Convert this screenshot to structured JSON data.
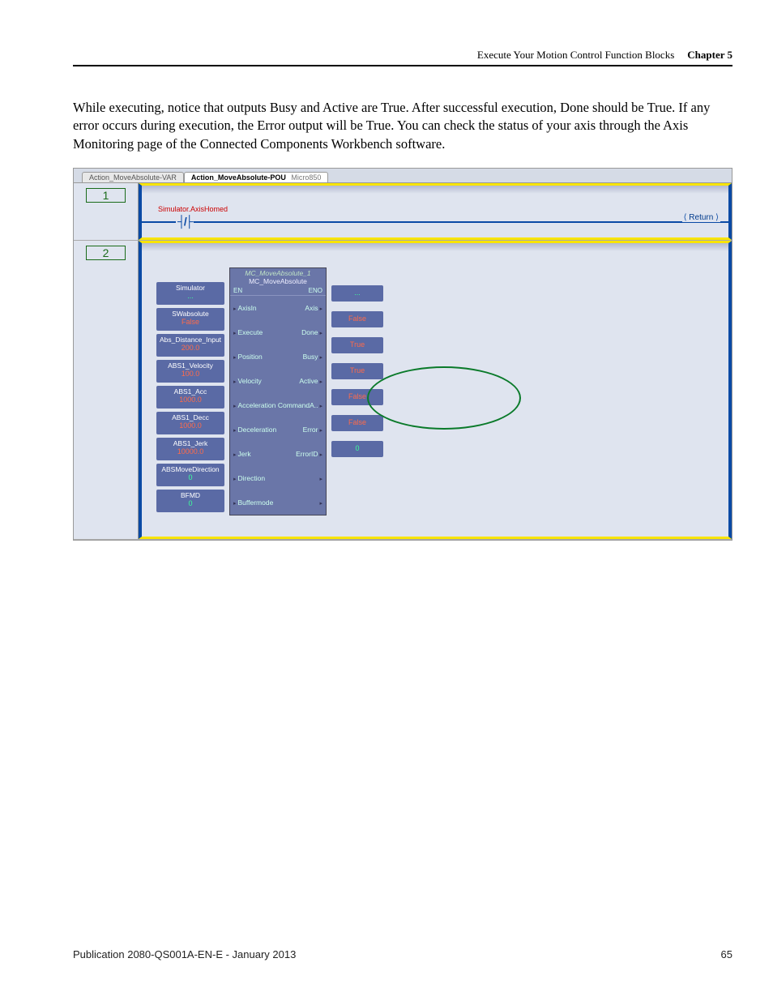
{
  "header": {
    "section": "Execute Your Motion Control Function Blocks",
    "chapter": "Chapter 5"
  },
  "body_paragraph": "While executing, notice that outputs Busy and Active are True. After successful execution, Done should be True. If any error occurs during execution, the Error output will be True. You can check the status of your axis through the Axis Monitoring page of the Connected Components Workbench software.",
  "screenshot": {
    "tabs": {
      "inactive": "Action_MoveAbsolute-VAR",
      "active": "Action_MoveAbsolute-POU",
      "active_sub": "Micro850"
    },
    "rung1": {
      "number": "1",
      "contact_label": "Simulator.AxisHomed",
      "contact_symbol": "┤/├",
      "return_label": "Return"
    },
    "rung2": {
      "number": "2",
      "fb_instance": "MC_MoveAbsolute_1",
      "fb_type": "MC_MoveAbsolute",
      "en": "EN",
      "eno": "ENO",
      "inputs": [
        {
          "name": "Simulator",
          "val": "...",
          "green": true,
          "pin": "AxisIn"
        },
        {
          "name": "SWabsolute",
          "val": "False",
          "green": false,
          "pin": "Execute"
        },
        {
          "name": "Abs_Distance_Input",
          "val": "200.0",
          "green": false,
          "pin": "Position"
        },
        {
          "name": "ABS1_Velocity",
          "val": "100.0",
          "green": false,
          "pin": "Velocity"
        },
        {
          "name": "ABS1_Acc",
          "val": "1000.0",
          "green": false,
          "pin": "Acceleration"
        },
        {
          "name": "ABS1_Decc",
          "val": "1000.0",
          "green": false,
          "pin": "Deceleration"
        },
        {
          "name": "ABS1_Jerk",
          "val": "10000.0",
          "green": false,
          "pin": "Jerk"
        },
        {
          "name": "ABSMoveDirection",
          "val": "0",
          "green": true,
          "pin": "Direction"
        },
        {
          "name": "BFMD",
          "val": "0",
          "green": true,
          "pin": "Buffermode"
        }
      ],
      "outputs": [
        {
          "pin": "Axis",
          "val": "...",
          "green": true
        },
        {
          "pin": "Done",
          "val": "False",
          "green": false
        },
        {
          "pin": "Busy",
          "val": "True",
          "green": false
        },
        {
          "pin": "Active",
          "val": "True",
          "green": false
        },
        {
          "pin": "CommandA..",
          "val": "False",
          "green": false
        },
        {
          "pin": "Error",
          "val": "False",
          "green": false
        },
        {
          "pin": "ErrorID",
          "val": "0",
          "green": true
        }
      ]
    }
  },
  "footer": {
    "pub": "Publication 2080-QS001A-EN-E - January 2013",
    "page": "65"
  }
}
